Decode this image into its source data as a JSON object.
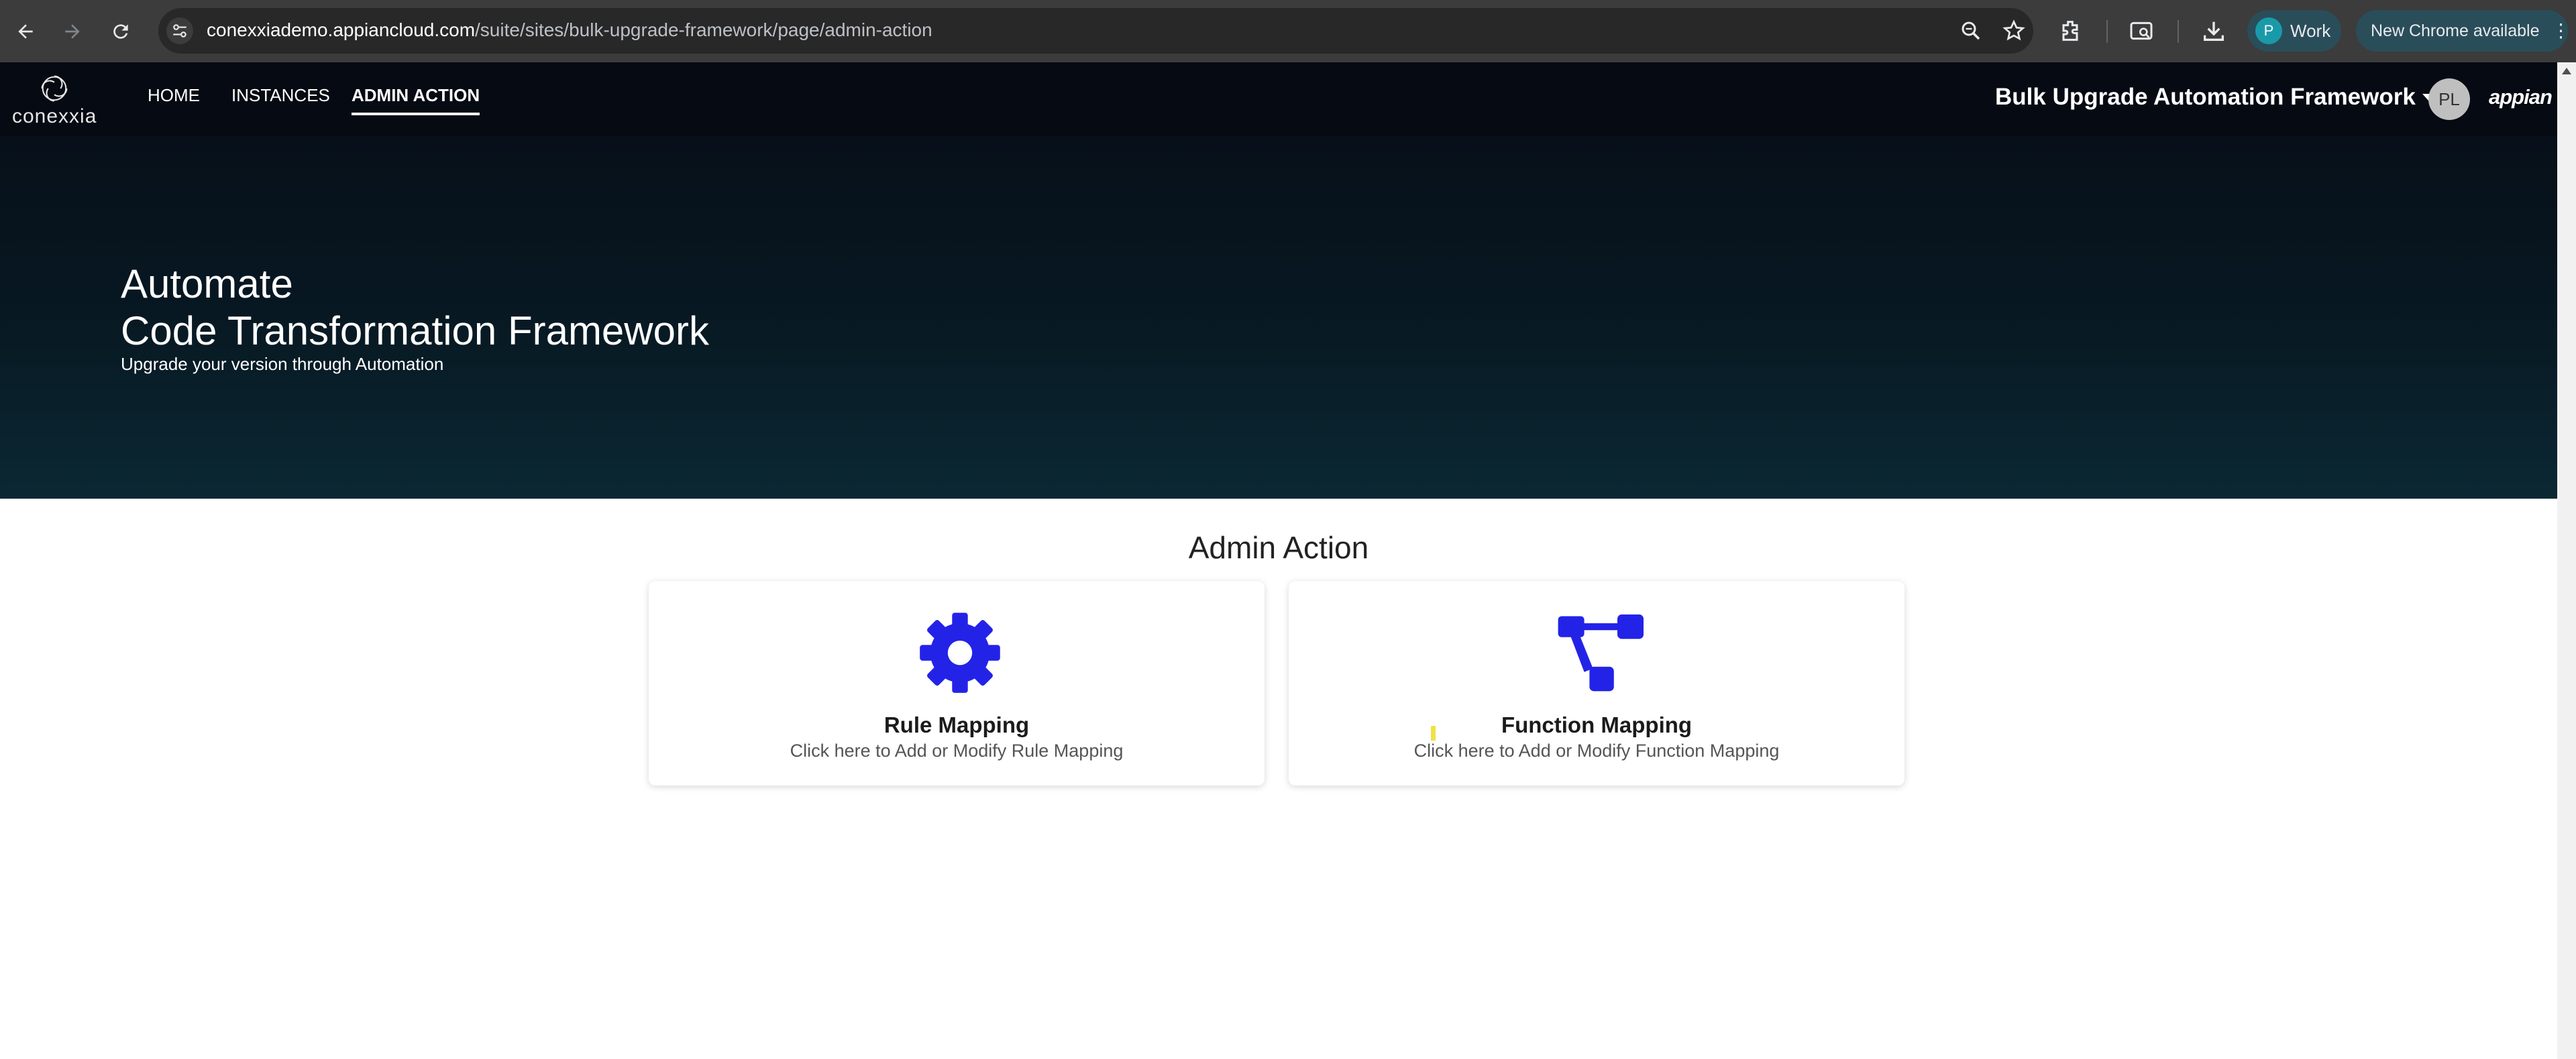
{
  "browser": {
    "url_host": "conexxiademo.appiancloud.com",
    "url_path": "/suite/sites/bulk-upgrade-framework/page/admin-action",
    "profile_initial": "P",
    "profile_label": "Work",
    "update_label": "New Chrome available"
  },
  "header": {
    "logo_text": "conexxia",
    "tabs": [
      {
        "label": "HOME",
        "active": false
      },
      {
        "label": "INSTANCES",
        "active": false
      },
      {
        "label": "ADMIN ACTION",
        "active": true
      }
    ],
    "site_name": "Bulk Upgrade Automation Framework",
    "user_initials": "PL",
    "brand": "appian"
  },
  "hero": {
    "title_line1": "Automate",
    "title_line2": "Code Transformation Framework",
    "subtitle": "Upgrade your version through Automation"
  },
  "main": {
    "section_title": "Admin Action",
    "cards": [
      {
        "title": "Rule Mapping",
        "description": "Click here to Add or Modify Rule Mapping",
        "icon": "gear-icon"
      },
      {
        "title": "Function Mapping",
        "description": "Click here to Add or Modify Function Mapping",
        "icon": "flow-diagram-icon"
      }
    ]
  },
  "colors": {
    "accent": "#2323e8",
    "header_bg": "#050a13",
    "hero_bottom": "#0b2833"
  }
}
